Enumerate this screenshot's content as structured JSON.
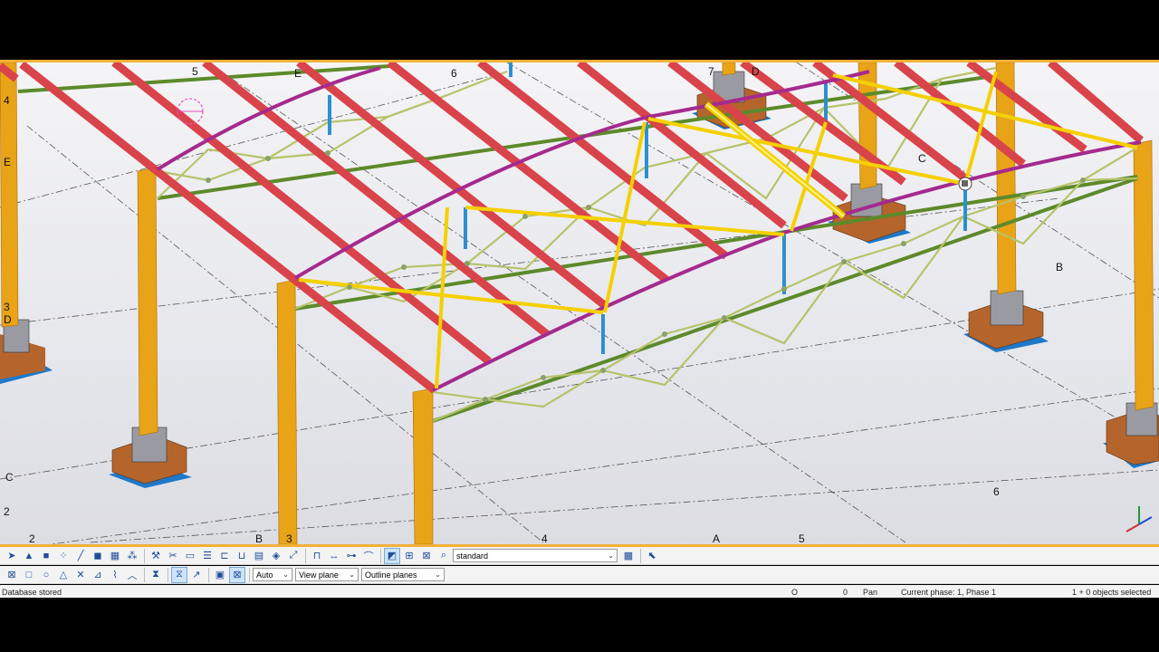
{
  "grid_labels": {
    "top_5": "5",
    "top_E": "E",
    "top_6": "6",
    "top_7": "7",
    "top_D": "D",
    "left_4": "4",
    "left_E": "E",
    "left_3": "3",
    "left_D": "D",
    "left_C": "C",
    "left_2": "2",
    "bottom_2": "2",
    "bottom_B": "B",
    "bottom_3": "3",
    "bottom_4": "4",
    "bottom_A": "A",
    "bottom_5": "5",
    "right_C": "C",
    "right_B": "B",
    "right_6": "6"
  },
  "toolbar2": {
    "auto_select": "Auto",
    "view_plane_select": "View plane",
    "outline_planes_select": "Outline planes"
  },
  "toolbar1": {
    "phase_select": "standard"
  },
  "status": {
    "message": "Database stored",
    "coord_o": "O",
    "coord_value": "0",
    "mode": "Pan",
    "phase": "Current phase: 1, Phase 1",
    "selection": "1 + 0 objects selected"
  },
  "colors": {
    "column": "#e8a317",
    "rafter": "#d9434a",
    "purlin_top": "#a52a8e",
    "purlin_green": "#5c8a2a",
    "truss": "#b7c36a",
    "brace": "#f5d000",
    "post": "#2e8fd0",
    "footing": "#b5652c",
    "footing_base": "#1f78c8",
    "pedestal": "#9a9aa2",
    "accent_border": "#f0b03a"
  }
}
